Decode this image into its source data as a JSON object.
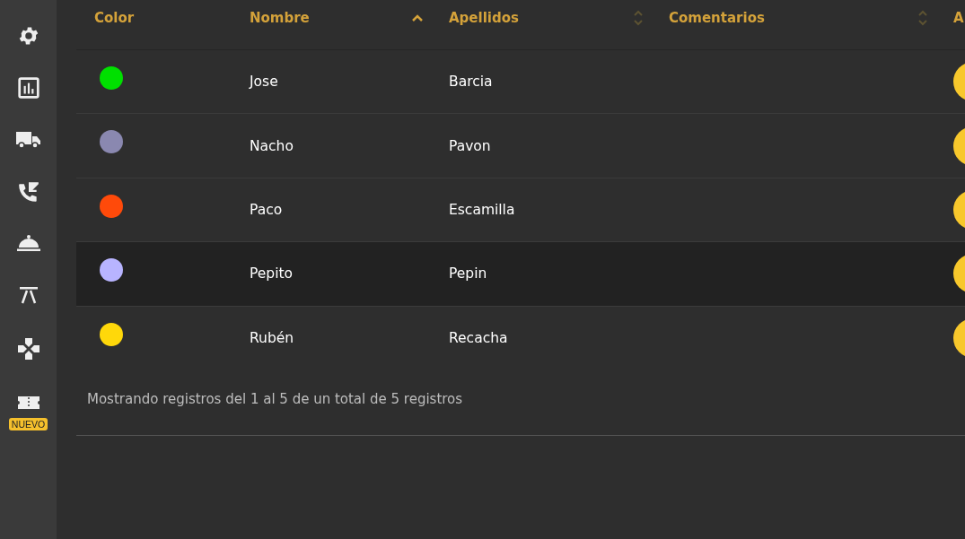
{
  "sidebar": {
    "items": [
      {
        "kind": "settings"
      },
      {
        "kind": "chart"
      },
      {
        "kind": "truck"
      },
      {
        "kind": "phone"
      },
      {
        "kind": "cloche"
      },
      {
        "kind": "easel"
      },
      {
        "kind": "gamepad"
      },
      {
        "kind": "ticket",
        "badge": "NUEVO"
      }
    ]
  },
  "table": {
    "columns": [
      {
        "label": "Color"
      },
      {
        "label": "Nombre",
        "sorted": true
      },
      {
        "label": "Apellidos",
        "sorted": false
      },
      {
        "label": "Comentarios",
        "sorted": false
      },
      {
        "label": "A"
      }
    ],
    "rows": [
      {
        "color": "#00e000",
        "nombre": "Jose",
        "apellidos": "Barcia",
        "highlighted": false
      },
      {
        "color": "#8a88b0",
        "nombre": "Nacho",
        "apellidos": "Pavon",
        "highlighted": false
      },
      {
        "color": "#ff4a0a",
        "nombre": "Paco",
        "apellidos": "Escamilla",
        "highlighted": false
      },
      {
        "color": "#b8b4ff",
        "nombre": "Pepito",
        "apellidos": "Pepin",
        "highlighted": true
      },
      {
        "color": "#ffd80a",
        "nombre": "Rubén",
        "apellidos": "Recacha",
        "highlighted": false
      }
    ]
  },
  "footer": {
    "info": "Mostrando registros del 1 al 5 de un total de 5 registros"
  }
}
